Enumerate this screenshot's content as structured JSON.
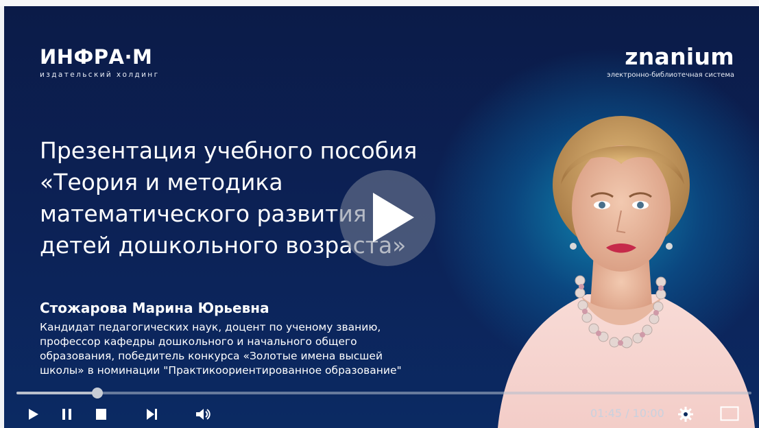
{
  "logo_left": {
    "brand": "ИНФРА·М",
    "subtitle": "издательский холдинг"
  },
  "logo_right": {
    "brand": "znanium",
    "subtitle": "электронно-библиотечная система"
  },
  "title_lines": [
    "Презентация учебного пособия",
    "«Теория и методика",
    "математического развития",
    "детей дошкольного возраста»"
  ],
  "author": {
    "name": "Стожарова Марина Юрьевна",
    "description_lines": [
      "Кандидат педагогических наук, доцент по ученому званию,",
      "профессор кафедры дошкольного и начального общего",
      "образования, победитель конкурса «Золотые имена высшей",
      "школы» в номинации \"Практикоориентированное образование\""
    ]
  },
  "player": {
    "current_time": "01:45",
    "duration": "10:00",
    "time_display": "01:45 / 10:00",
    "progress_fraction": 0.11,
    "icons": [
      "play-icon",
      "pause-icon",
      "stop-icon",
      "skip-next-icon",
      "volume-icon",
      "settings-icon",
      "fullscreen-icon"
    ]
  },
  "colors": {
    "background": "#0b1b48",
    "glow": "#1096be",
    "text": "#ffffff",
    "controls": "#ffffff"
  }
}
